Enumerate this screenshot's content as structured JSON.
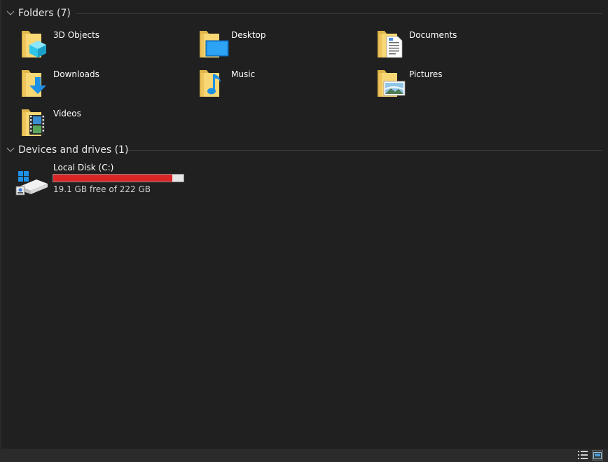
{
  "groups": {
    "folders": {
      "title": "Folders (7)",
      "items": [
        {
          "label": "3D Objects",
          "icon": "3d-objects-folder-icon"
        },
        {
          "label": "Desktop",
          "icon": "desktop-folder-icon"
        },
        {
          "label": "Documents",
          "icon": "documents-folder-icon"
        },
        {
          "label": "Downloads",
          "icon": "downloads-folder-icon"
        },
        {
          "label": "Music",
          "icon": "music-folder-icon"
        },
        {
          "label": "Pictures",
          "icon": "pictures-folder-icon"
        },
        {
          "label": "Videos",
          "icon": "videos-folder-icon"
        }
      ]
    },
    "devices": {
      "title": "Devices and drives (1)",
      "items": [
        {
          "label": "Local Disk (C:)",
          "free_text": "19.1 GB free of 222 GB",
          "used_fraction": 0.914,
          "icon": "local-disk-icon"
        }
      ]
    }
  },
  "status_bar": {
    "details_view_icon": "details-view-icon",
    "large_icons_view_icon": "large-icons-view-icon"
  },
  "colors": {
    "background": "#202020",
    "folder_yellow": "#f8d775",
    "drive_bar_critical": "#da2626",
    "accent_blue": "#1e90e6"
  }
}
